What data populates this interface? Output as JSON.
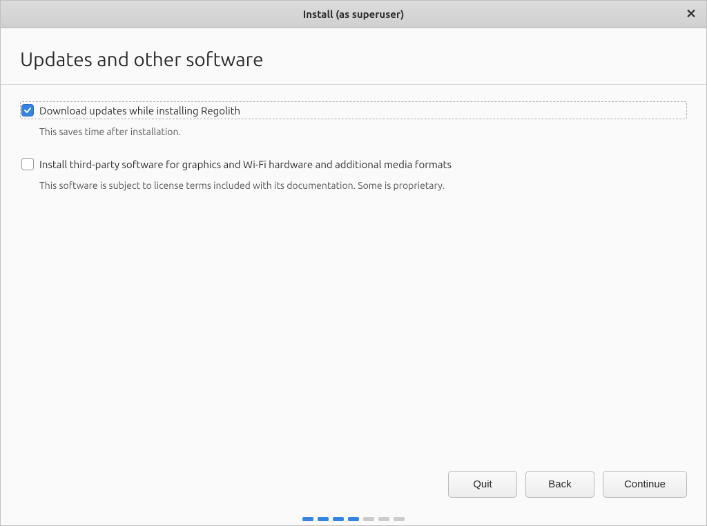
{
  "titlebar": {
    "title": "Install (as superuser)"
  },
  "page": {
    "heading": "Updates and other software"
  },
  "options": {
    "download_updates": {
      "label": "Download updates while installing Regolith",
      "description": "This saves time after installation.",
      "checked": true
    },
    "third_party": {
      "label": "Install third-party software for graphics and Wi-Fi hardware and additional media formats",
      "description": "This software is subject to license terms included with its documentation. Some is proprietary.",
      "checked": false
    }
  },
  "buttons": {
    "quit": "Quit",
    "back": "Back",
    "continue": "Continue"
  },
  "progress": {
    "total": 7,
    "active": [
      0,
      1,
      2,
      3
    ]
  }
}
